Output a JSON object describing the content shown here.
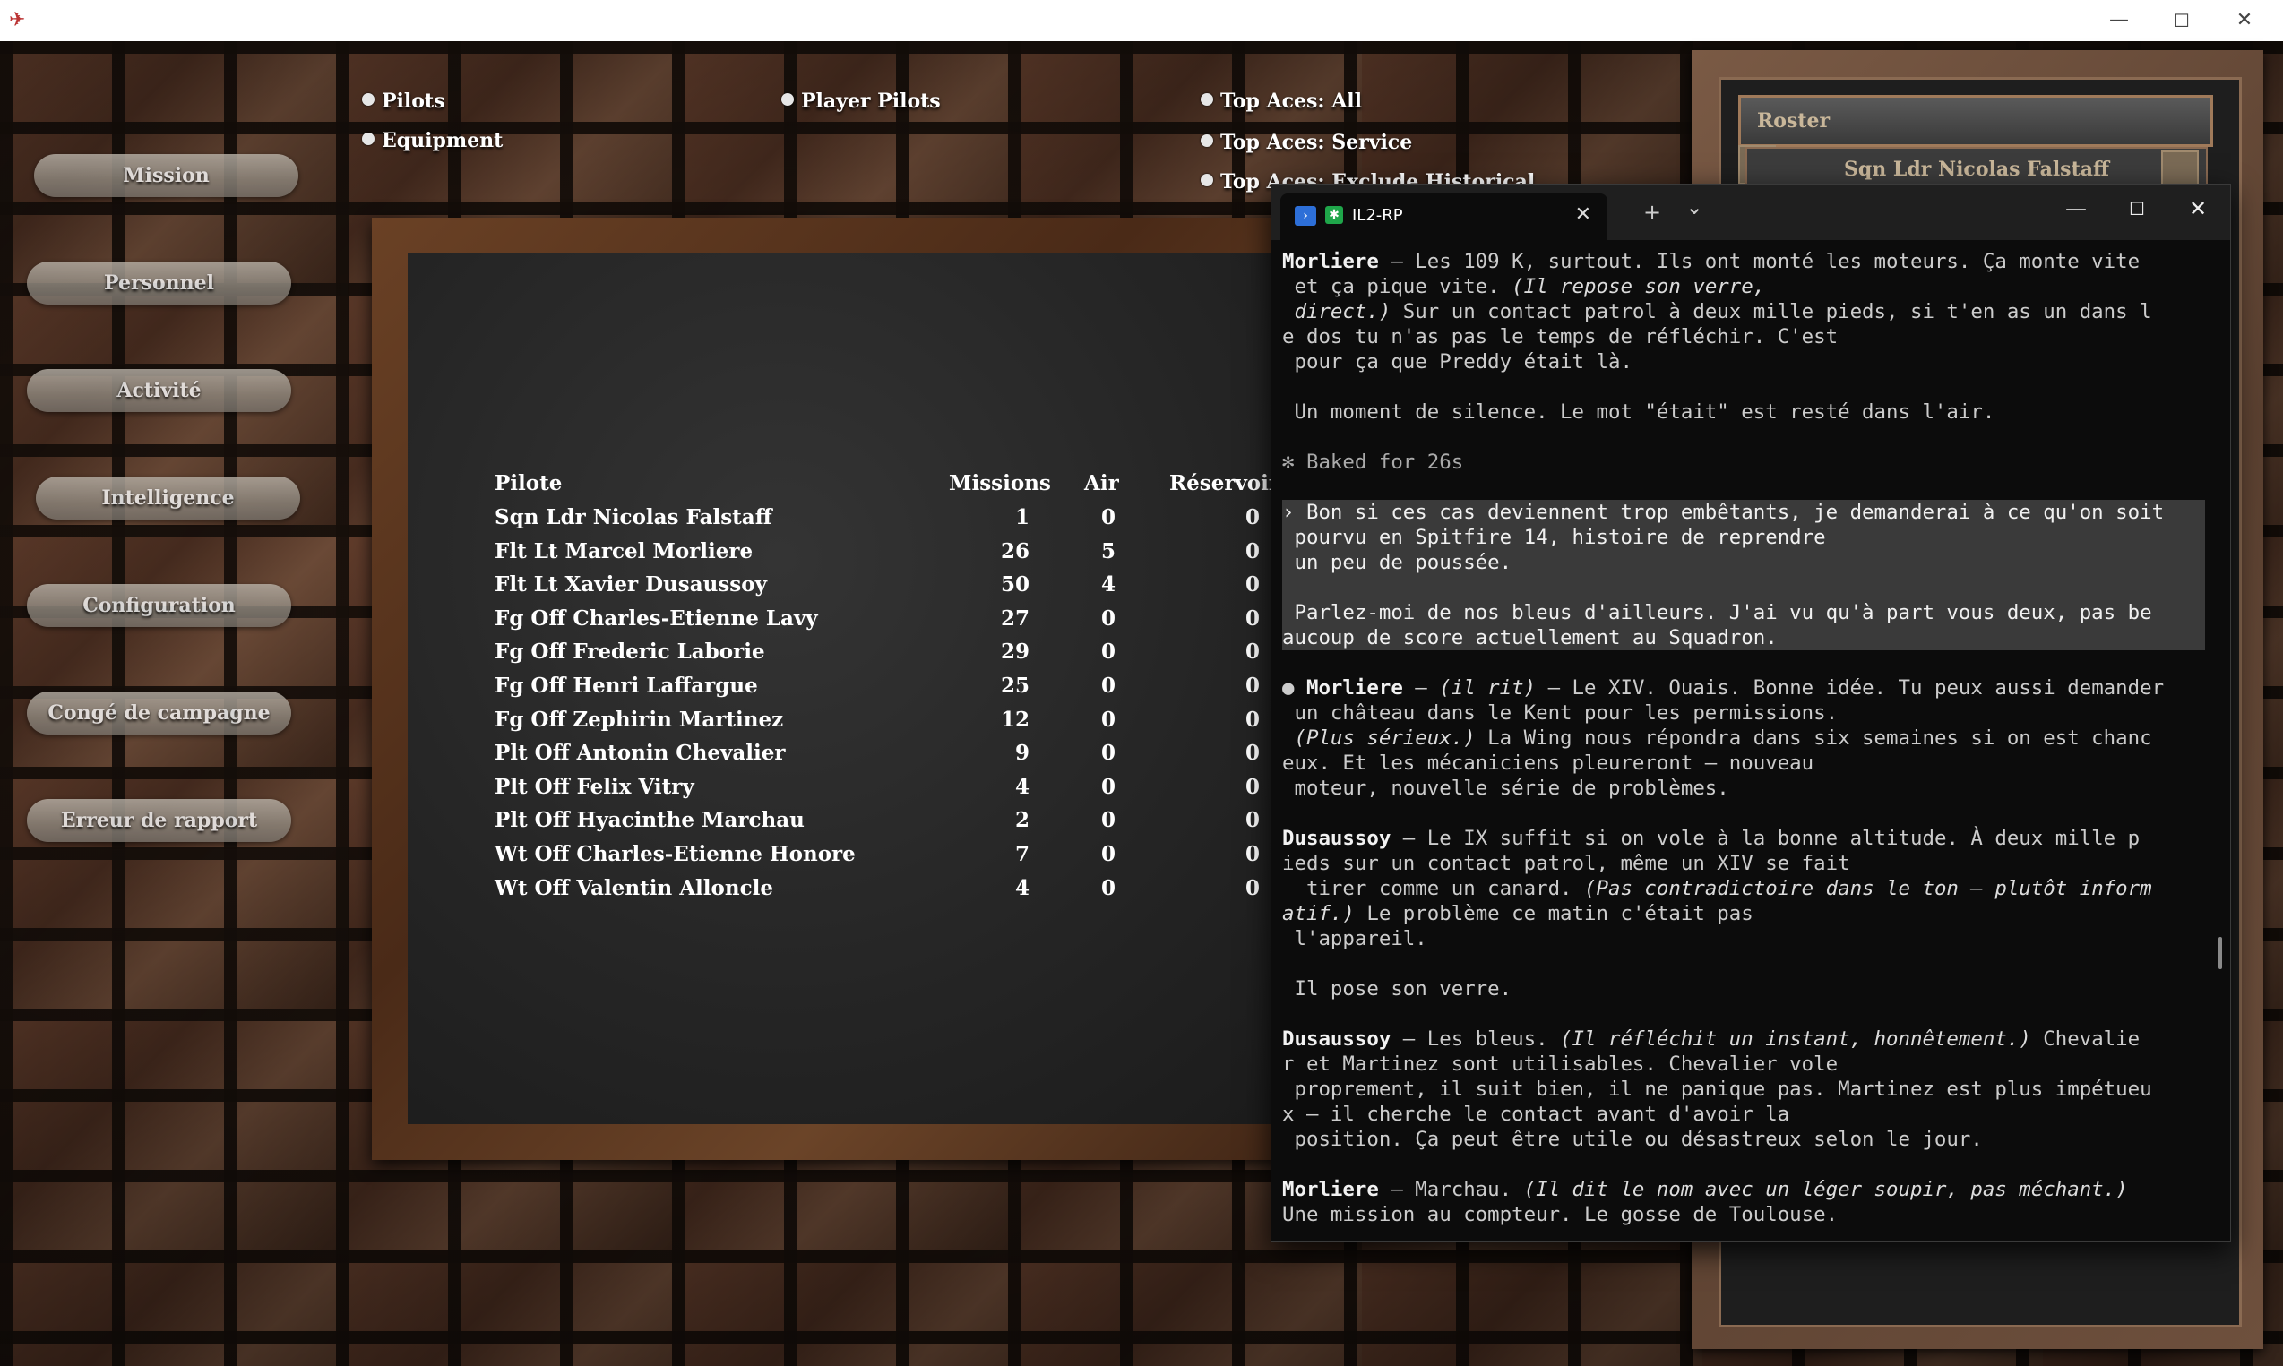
{
  "window": {
    "minimize": "—",
    "maximize": "☐",
    "close": "✕"
  },
  "nav": [
    {
      "label": "Mission"
    },
    {
      "label": "Personnel"
    },
    {
      "label": "Activité"
    },
    {
      "label": "Intelligence"
    },
    {
      "label": "Configuration"
    },
    {
      "label": "Congé de campagne"
    },
    {
      "label": "Erreur de rapport"
    }
  ],
  "options": {
    "pilots": "Pilots",
    "equipment": "Equipment",
    "player_pilots": "Player Pilots",
    "top_aces_all": "Top Aces: All",
    "top_aces_service": "Top Aces: Service",
    "top_aces_exclude": "Top Aces: Exclude Historical"
  },
  "table": {
    "headers": {
      "pilote": "Pilote",
      "missions": "Missions",
      "air": "Air",
      "reservoir": "Réservoir"
    },
    "rows": [
      {
        "name": "Sqn Ldr Nicolas Falstaff",
        "missions": "1",
        "air": "0",
        "reservoir": "0"
      },
      {
        "name": "Flt Lt Marcel Morliere",
        "missions": "26",
        "air": "5",
        "reservoir": "0"
      },
      {
        "name": "Flt Lt Xavier Dusaussoy",
        "missions": "50",
        "air": "4",
        "reservoir": "0"
      },
      {
        "name": "Fg Off Charles-Etienne Lavy",
        "missions": "27",
        "air": "0",
        "reservoir": "0"
      },
      {
        "name": "Fg Off Frederic Laborie",
        "missions": "29",
        "air": "0",
        "reservoir": "0"
      },
      {
        "name": "Fg Off Henri Laffargue",
        "missions": "25",
        "air": "0",
        "reservoir": "0"
      },
      {
        "name": "Fg Off Zephirin Martinez",
        "missions": "12",
        "air": "0",
        "reservoir": "0"
      },
      {
        "name": "Plt Off Antonin Chevalier",
        "missions": "9",
        "air": "0",
        "reservoir": "0"
      },
      {
        "name": "Plt Off Felix Vitry",
        "missions": "4",
        "air": "0",
        "reservoir": "0"
      },
      {
        "name": "Plt Off Hyacinthe Marchau",
        "missions": "2",
        "air": "0",
        "reservoir": "0"
      },
      {
        "name": "Wt Off Charles-Etienne Honore",
        "missions": "7",
        "air": "0",
        "reservoir": "0"
      },
      {
        "name": "Wt Off Valentin Alloncle",
        "missions": "4",
        "air": "0",
        "reservoir": "0"
      }
    ]
  },
  "roster": {
    "title": "Roster",
    "first_item": "Sqn Ldr Nicolas Falstaff"
  },
  "terminal": {
    "tab_title": "IL2-RP",
    "new_tab": "+",
    "dropdown": "⌄",
    "minimize": "—",
    "maximize": "☐",
    "close": "✕",
    "tab_close": "✕",
    "lines": {
      "l1_speaker": "Morliere",
      "l1_text": " — Les 109 K, surtout. Ils ont monté les moteurs. Ça monte vite",
      "l2": " et ça pique vite. ",
      "l2_italic": "(Il repose son verre,",
      "l3_italic": " direct.)",
      "l3_text": " Sur un contact patrol à deux mille pieds, si t'en as un dans l",
      "l4": "e dos tu n'as pas le temps de réfléchir. C'est",
      "l5": " pour ça que Preddy était là.",
      "l7": " Un moment de silence. Le mot \"était\" est resté dans l'air.",
      "l9": "✻ Baked for 26s",
      "l11": "› Bon si ces cas deviennent trop embêtants, je demanderai à ce qu'on soit",
      "l12": " pourvu en Spitfire 14, histoire de reprendre",
      "l13": " un peu de poussée.",
      "l15": " Parlez-moi de nos bleus d'ailleurs. J'ai vu qu'à part vous deux, pas be",
      "l16": "aucoup de score actuellement au Squadron.",
      "l18_bullet": "● ",
      "l18_speaker": "Morliere",
      "l18_a": " — ",
      "l18_italic": "(il rit)",
      "l18_b": " — Le XIV. Ouais. Bonne idée. Tu peux aussi demander",
      "l19": " un château dans le Kent pour les permissions.",
      "l20_italic": " (Plus sérieux.)",
      "l20_text": " La Wing nous répondra dans six semaines si on est chanc",
      "l21": "eux. Et les mécaniciens pleureront — nouveau",
      "l22": " moteur, nouvelle série de problèmes.",
      "l24_speaker": "Dusaussoy",
      "l24_text": " — Le IX suffit si on vole à la bonne altitude. À deux mille p",
      "l25": "ieds sur un contact patrol, même un XIV se fait",
      "l26_text": "  tirer comme un canard. ",
      "l26_italic": "(Pas contradictoire dans le ton — plutôt inform",
      "l27_italic": "atif.)",
      "l27_text": " Le problème ce matin c'était pas",
      "l28": " l'appareil.",
      "l30": " Il pose son verre.",
      "l32_speaker": "Dusaussoy",
      "l32_a": " — Les bleus. ",
      "l32_italic": "(Il réfléchit un instant, honnêtement.)",
      "l32_b": " Chevalie",
      "l33": "r et Martinez sont utilisables. Chevalier vole",
      "l34": " proprement, il suit bien, il ne panique pas. Martinez est plus impétueu",
      "l35": "x — il cherche le contact avant d'avoir la",
      "l36": " position. Ça peut être utile ou désastreux selon le jour.",
      "l38_speaker": "Morliere",
      "l38_a": " — Marchau. ",
      "l38_italic": "(Il dit le nom avec un léger soupir, pas méchant.)",
      "l39": "Une mission au compteur. Le gosse de Toulouse."
    }
  }
}
